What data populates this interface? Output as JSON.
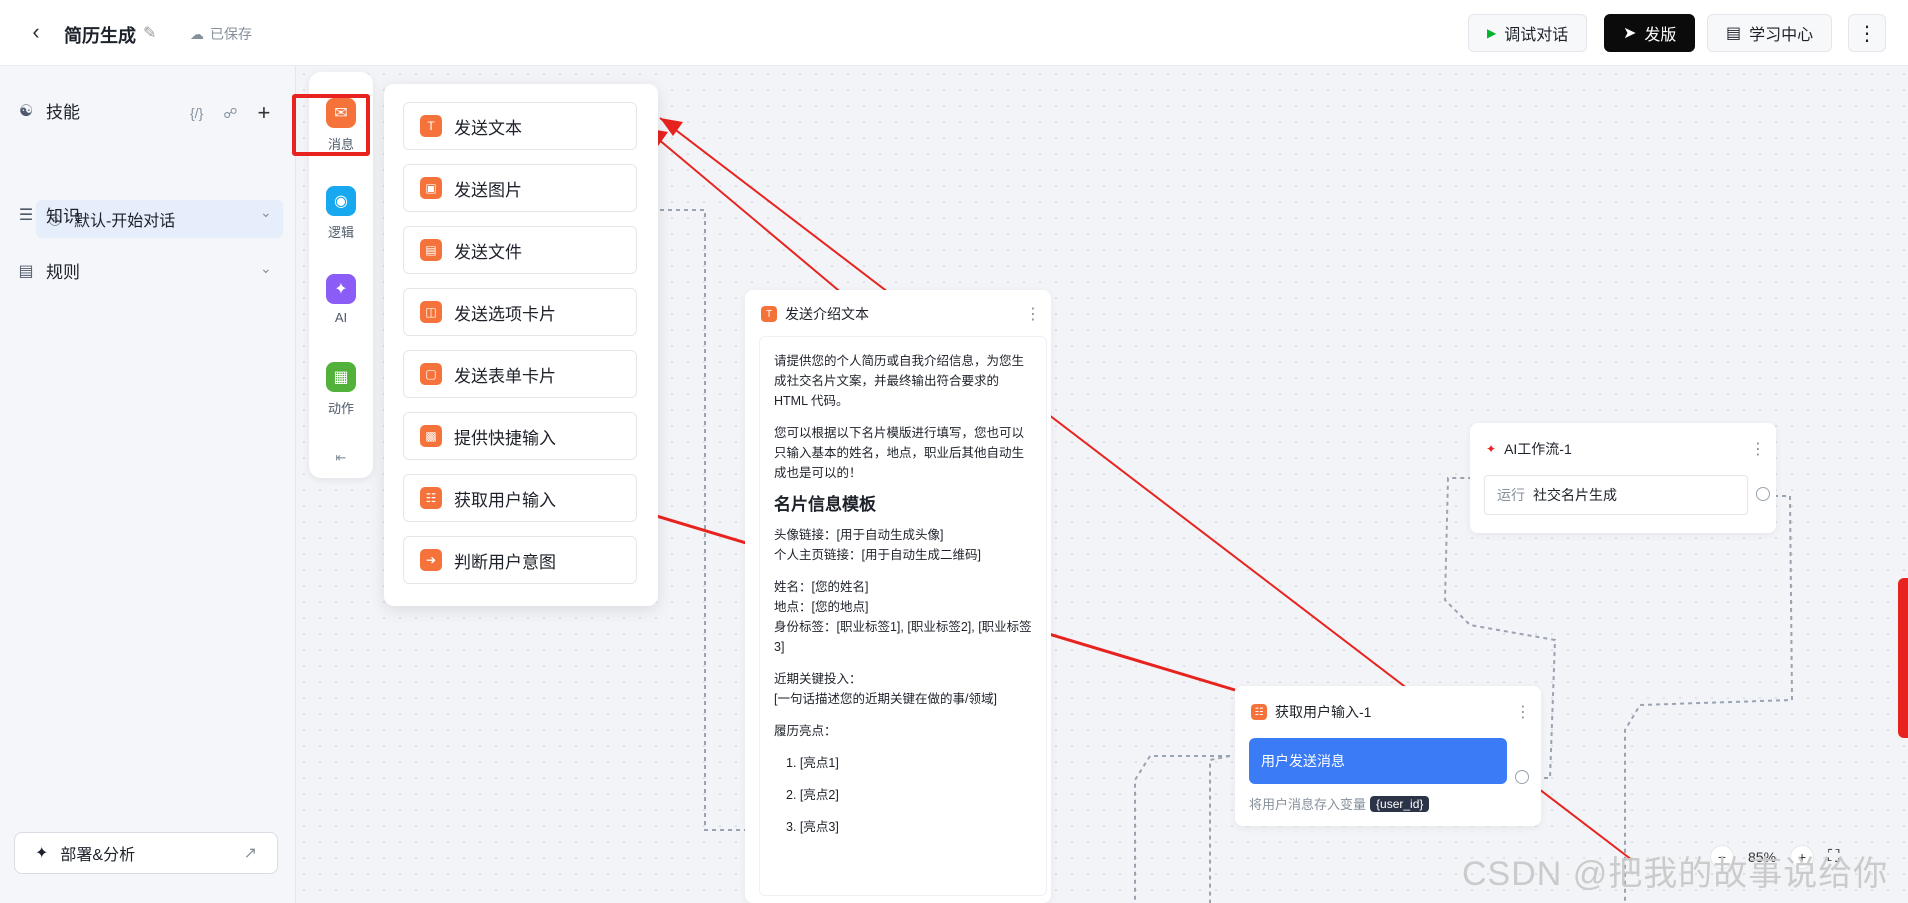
{
  "header": {
    "title": "简历生成",
    "saved": "已保存",
    "debug_label": "调试对话",
    "publish_label": "发版",
    "learn_label": "学习中心"
  },
  "sidebar": {
    "skills_label": "技能",
    "skill_item": "默认-开始对话",
    "knowledge_label": "知识",
    "rules_label": "规则",
    "deploy_label": "部署&分析"
  },
  "nodebar": {
    "message": "消息",
    "logic": "逻辑",
    "ai": "AI",
    "action": "动作"
  },
  "menu": {
    "items": [
      "发送文本",
      "发送图片",
      "发送文件",
      "发送选项卡片",
      "发送表单卡片",
      "提供快捷输入",
      "获取用户输入",
      "判断用户意图"
    ]
  },
  "intro_card": {
    "title": "发送介绍文本",
    "p1": "请提供您的个人简历或自我介绍信息，为您生成社交名片文案，并最终输出符合要求的 HTML 代码。",
    "p2": "您可以根据以下名片模版进行填写，您也可以只输入基本的姓名，地点，职业后其他自动生成也是可以的！",
    "heading": "名片信息模板",
    "p3": "头像链接：[用于自动生成头像]\n个人主页链接：[用于自动生成二维码]",
    "p4": "姓名：[您的姓名]\n地点：[您的地点]\n身份标签：[职业标签1], [职业标签2], [职业标签3]",
    "p5": "近期关键投入：\n[一句话描述您的近期关键在做的事/领域]",
    "p6": "履历亮点：",
    "list": [
      "1. [亮点1]",
      "2. [亮点2]",
      "3. [亮点3]"
    ]
  },
  "ai_card": {
    "title": "AI工作流-1",
    "run_prefix": "运行",
    "run_target": "社交名片生成"
  },
  "input_card": {
    "title": "获取用户输入-1",
    "button": "用户发送消息",
    "hint": "将用户消息存入变量",
    "var": "{user_id}"
  },
  "zoom": {
    "level": "85%"
  },
  "watermark": "CSDN @把我的故事说给你",
  "colors": {
    "accent_orange": "#f5733b",
    "highlight_red": "#e8231f",
    "primary_blue": "#3b7bf6"
  }
}
